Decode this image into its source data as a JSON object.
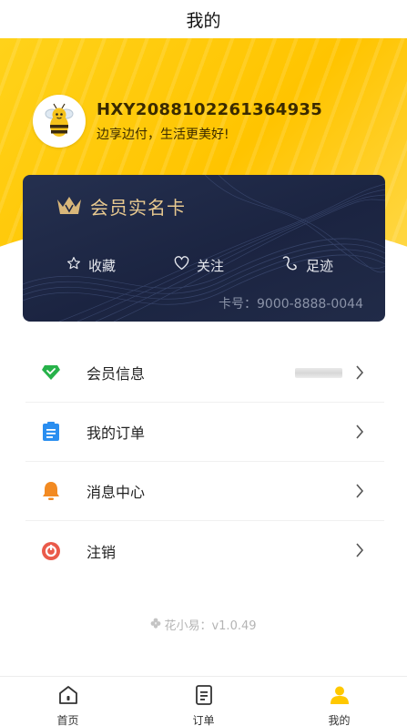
{
  "header": {
    "title": "我的"
  },
  "profile": {
    "username": "HXY2088102261364935",
    "slogan": "边享边付，生活更美好!",
    "avatar_icon": "bee-avatar-icon"
  },
  "card": {
    "title": "会员实名卡",
    "crown_icon": "crown-icon",
    "actions": [
      {
        "label": "收藏",
        "icon": "star-outline-icon"
      },
      {
        "label": "关注",
        "icon": "heart-outline-icon"
      },
      {
        "label": "足迹",
        "icon": "footprint-icon"
      }
    ],
    "card_number": "卡号：9000-8888-0044"
  },
  "menu": {
    "items": [
      {
        "label": "会员信息",
        "icon": "diamond-icon",
        "icon_color": "#27b24a"
      },
      {
        "label": "我的订单",
        "icon": "clipboard-icon",
        "icon_color": "#2a8ef0"
      },
      {
        "label": "消息中心",
        "icon": "bell-icon",
        "icon_color": "#f28a22"
      },
      {
        "label": "注销",
        "icon": "logout-icon",
        "icon_color": "#ea5a4a"
      }
    ]
  },
  "footer": {
    "version": "花小易：v1.0.49"
  },
  "tabbar": {
    "tabs": [
      {
        "label": "首页",
        "icon": "home-icon"
      },
      {
        "label": "订单",
        "icon": "order-icon"
      },
      {
        "label": "我的",
        "icon": "user-icon",
        "active": true
      }
    ],
    "active_color": "#ffc800"
  },
  "colors": {
    "brand_yellow": "#ffc800",
    "card_navy": "#1f2845",
    "card_gold": "#e8c990"
  }
}
